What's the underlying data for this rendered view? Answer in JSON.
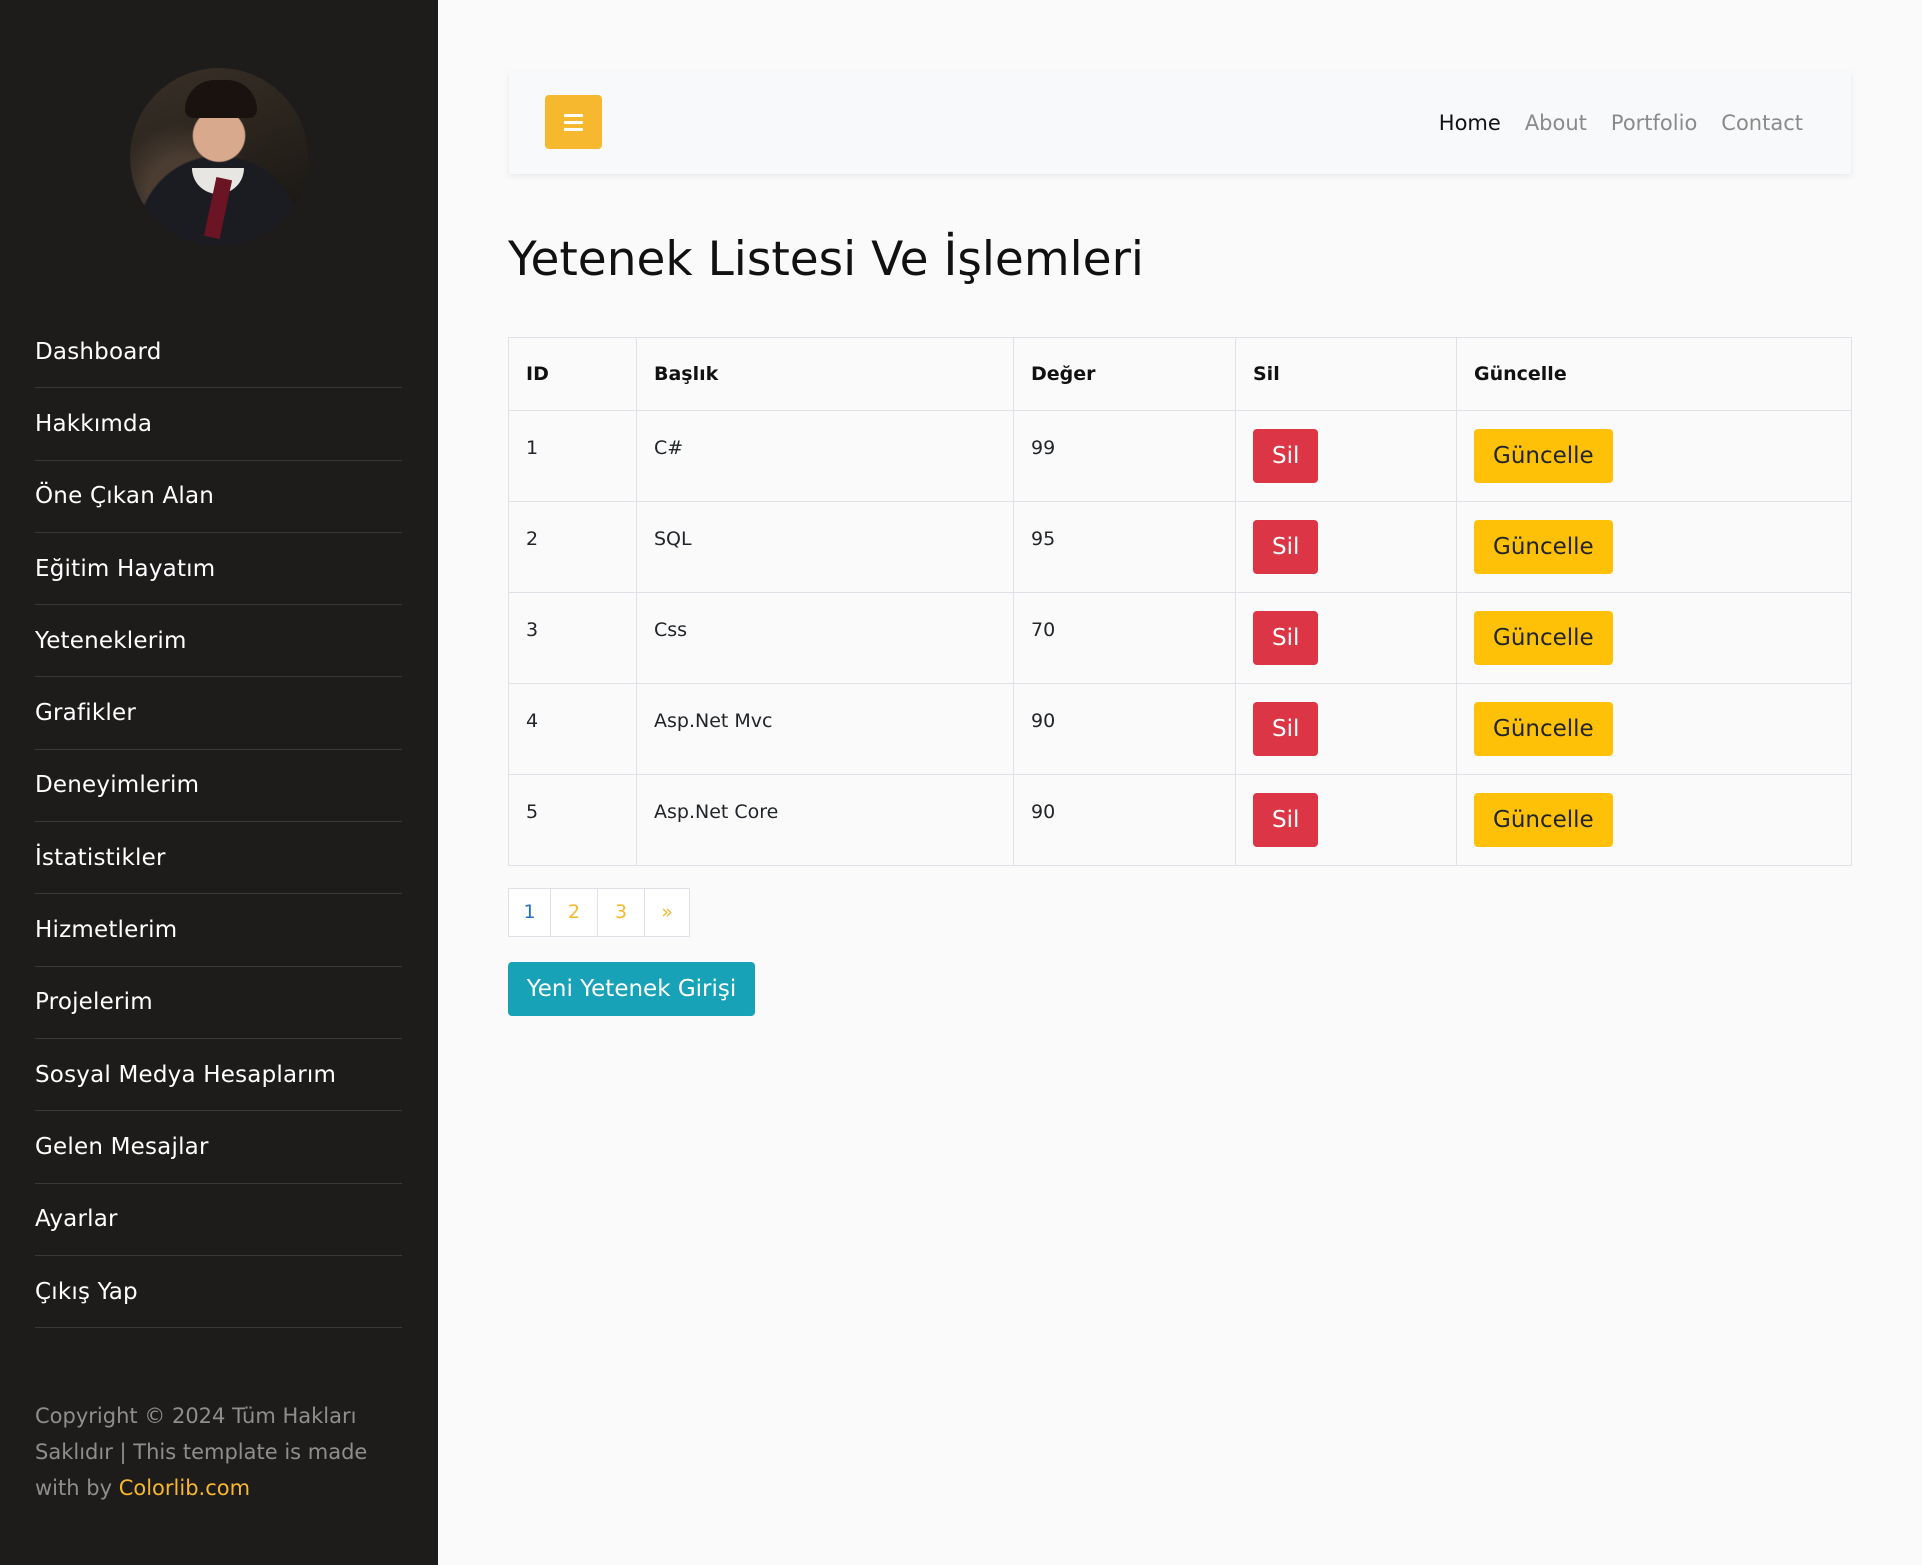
{
  "sidebar": {
    "avatar": "profile-photo",
    "items": [
      {
        "label": "Dashboard"
      },
      {
        "label": "Hakkımda"
      },
      {
        "label": "Öne Çıkan Alan"
      },
      {
        "label": "Eğitim Hayatım"
      },
      {
        "label": "Yeteneklerim"
      },
      {
        "label": "Grafikler"
      },
      {
        "label": "Deneyimlerim"
      },
      {
        "label": "İstatistikler"
      },
      {
        "label": "Hizmetlerim"
      },
      {
        "label": "Projelerim"
      },
      {
        "label": "Sosyal Medya Hesaplarım"
      },
      {
        "label": "Gelen Mesajlar"
      },
      {
        "label": "Ayarlar"
      },
      {
        "label": "Çıkış Yap"
      }
    ],
    "copyright_text": "Copyright © 2024 Tüm Hakları Saklıdır | This template is made with",
    "copyright_by": "by",
    "copyright_link": "Colorlib.com"
  },
  "navbar": {
    "toggle_icon": "hamburger-icon",
    "links": [
      {
        "label": "Home"
      },
      {
        "label": "About"
      },
      {
        "label": "Portfolio"
      },
      {
        "label": "Contact"
      }
    ]
  },
  "page": {
    "title": "Yetenek Listesi Ve İşlemleri"
  },
  "table": {
    "headers": [
      "ID",
      "Başlık",
      "Değer",
      "Sil",
      "Güncelle"
    ],
    "rows": [
      {
        "id": "1",
        "title": "C#",
        "value": "99",
        "delete": "Sil",
        "update": "Güncelle"
      },
      {
        "id": "2",
        "title": "SQL",
        "value": "95",
        "delete": "Sil",
        "update": "Güncelle"
      },
      {
        "id": "3",
        "title": "Css",
        "value": "70",
        "delete": "Sil",
        "update": "Güncelle"
      },
      {
        "id": "4",
        "title": "Asp.Net Mvc",
        "value": "90",
        "delete": "Sil",
        "update": "Güncelle"
      },
      {
        "id": "5",
        "title": "Asp.Net Core",
        "value": "90",
        "delete": "Sil",
        "update": "Güncelle"
      }
    ]
  },
  "pagination": {
    "pages": [
      "1",
      "2",
      "3",
      "»"
    ],
    "current": "1"
  },
  "actions": {
    "new_button": "Yeni Yetenek Girişi"
  },
  "colors": {
    "sidebar_bg": "#1e1b1b",
    "accent": "#f5b82e",
    "danger": "#dc3545",
    "warning": "#ffc107",
    "info": "#17a2b8"
  }
}
